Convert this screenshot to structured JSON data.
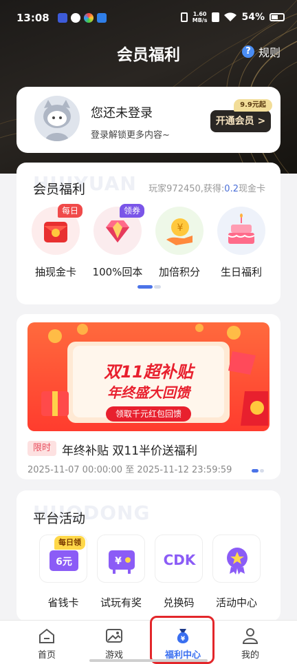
{
  "status_bar": {
    "time": "13:08",
    "net_speed_value": "1.60",
    "net_speed_unit": "MB/s",
    "battery": "54%"
  },
  "header": {
    "title": "会员福利",
    "rules_label": "规则",
    "rules_icon": "question-icon"
  },
  "login_card": {
    "title": "您还未登录",
    "subtitle": "登录解锁更多内容~",
    "vip_button": "开通会员 >",
    "price_tag": "9.9元起"
  },
  "member_benefits": {
    "title": "会员福利",
    "watermark": "HUIYUAN",
    "player_info": "玩家972450,获得:",
    "amount": "0.2",
    "card_suffix": "现金卡",
    "items": [
      {
        "label": "抽现金卡",
        "badge": "每日",
        "icon": "red-envelope-icon"
      },
      {
        "label": "100%回本",
        "badge": "领券",
        "icon": "diamond-icon"
      },
      {
        "label": "加倍积分",
        "badge": "",
        "icon": "coin-hand-icon"
      },
      {
        "label": "生日福利",
        "badge": "",
        "icon": "birthday-cake-icon"
      }
    ]
  },
  "promotion": {
    "banner_title_1": "双11超补贴",
    "banner_title_2": "年终盛大回馈",
    "banner_button": "领取千元红包回馈",
    "tag": "限时",
    "title": "年终补贴 双11半价送福利",
    "time_range": "2025-11-07 00:00:00 至 2025-11-12 23:59:59"
  },
  "platform_activity": {
    "title": "平台活动",
    "watermark": "HUODONG",
    "items": [
      {
        "label": "省钱卡",
        "badge": "每日领",
        "icon_text": "6元",
        "icon": "savings-card-icon"
      },
      {
        "label": "试玩有奖",
        "badge": "",
        "icon_text": "¥",
        "icon": "trial-reward-icon"
      },
      {
        "label": "兑换码",
        "badge": "",
        "icon_text": "CDK",
        "icon": "cdk-icon"
      },
      {
        "label": "活动中心",
        "badge": "",
        "icon_text": "",
        "icon": "activity-medal-icon"
      }
    ]
  },
  "tabbar": {
    "tabs": [
      {
        "label": "首页",
        "icon": "home-icon"
      },
      {
        "label": "游戏",
        "icon": "game-icon"
      },
      {
        "label": "福利中心",
        "icon": "money-bag-icon"
      },
      {
        "label": "我的",
        "icon": "user-icon"
      }
    ],
    "active_index": 2
  },
  "colors": {
    "accent": "#3a6ff0",
    "highlight": "#e3262a",
    "vip_dark": "#2a2724",
    "gold": "#f2dd98"
  }
}
